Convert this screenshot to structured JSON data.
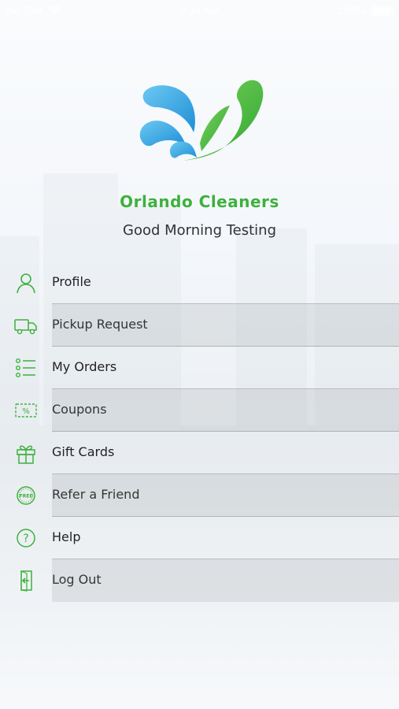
{
  "status_bar": {
    "carrier": "No SIM",
    "time": "9:24 AM",
    "battery": "100%"
  },
  "brand": {
    "name": "Orlando Cleaners",
    "greeting": "Good Morning Testing",
    "colors": {
      "green": "#3db13d",
      "blue": "#2b9fe0"
    }
  },
  "menu": [
    {
      "label": "Profile",
      "icon": "person-icon"
    },
    {
      "label": "Pickup Request",
      "icon": "truck-icon"
    },
    {
      "label": "My Orders",
      "icon": "list-icon"
    },
    {
      "label": "Coupons",
      "icon": "coupon-icon"
    },
    {
      "label": "Gift Cards",
      "icon": "gift-icon"
    },
    {
      "label": "Refer a Friend",
      "icon": "free-badge-icon"
    },
    {
      "label": "Help",
      "icon": "help-icon"
    },
    {
      "label": "Log Out",
      "icon": "logout-icon"
    }
  ]
}
